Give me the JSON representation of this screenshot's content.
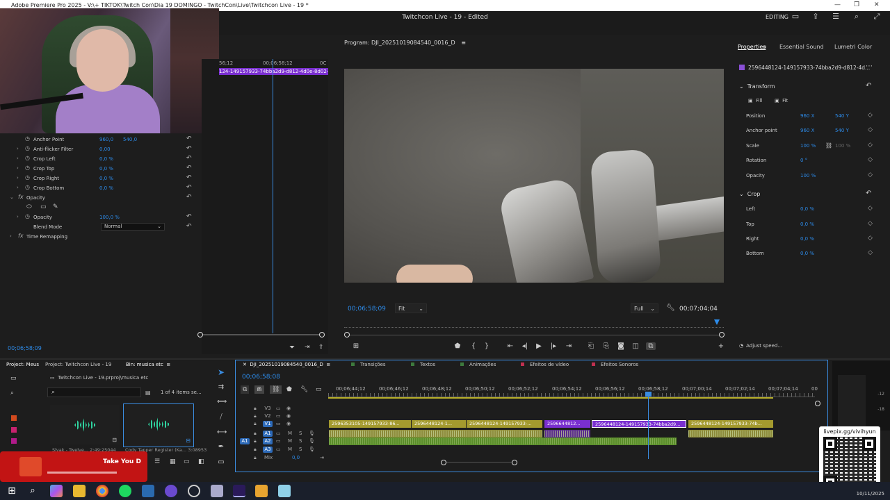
{
  "window": {
    "title": "Adobe Premiere Pro 2025 - V:\\+ TIKTOK\\Twitch Con\\Dia 19 DOMINGO - TwitchCon\\Live\\Twitchcon Live - 19 *",
    "project_title": "Twitchcon Live - 19",
    "edited_label": "Edited",
    "workspace": "EDITING"
  },
  "effect_controls": {
    "rows": [
      {
        "label": "Anchor Point",
        "v1": "960,0",
        "v2": "540,0"
      },
      {
        "label": "Anti-flicker Filter",
        "v1": "0,00",
        "v2": ""
      },
      {
        "label": "Crop Left",
        "v1": "0,0 %",
        "v2": ""
      },
      {
        "label": "Crop Top",
        "v1": "0,0 %",
        "v2": ""
      },
      {
        "label": "Crop Right",
        "v1": "0,0 %",
        "v2": ""
      },
      {
        "label": "Crop Bottom",
        "v1": "0,0 %",
        "v2": ""
      }
    ],
    "opacity_section": "Opacity",
    "opacity_label": "Opacity",
    "opacity_value": "100,0 %",
    "blend_label": "Blend Mode",
    "blend_value": "Normal",
    "time_remapping": "Time Remapping",
    "mini_ruler_left": "56;12",
    "mini_ruler_mid": "00;06;58;12",
    "mini_ruler_right": "0C",
    "mini_clip": "124-149157933-74bba2d9-d812-4d0e-8d02-ce",
    "current_time": "00;06;58;09"
  },
  "program_monitor": {
    "tab": "Program: DJI_20251019084540_0016_D",
    "timecode": "00;06;58;09",
    "zoom": "Fit",
    "resolution": "Full",
    "duration": "00;07;04;04"
  },
  "properties": {
    "tabs": [
      "Properties",
      "Essential Sound",
      "Lumetri Color"
    ],
    "clip_name": "2596448124-149157933-74bba2d9-d812-4d...",
    "transform": "Transform",
    "fill": "Fill",
    "fit": "Fit",
    "rows": [
      {
        "label": "Position",
        "a": "960 X",
        "b": "540 Y"
      },
      {
        "label": "Anchor point",
        "a": "960 X",
        "b": "540 Y"
      },
      {
        "label": "Scale",
        "a": "100 %",
        "b": "100 %"
      },
      {
        "label": "Rotation",
        "a": "0 °",
        "b": ""
      },
      {
        "label": "Opacity",
        "a": "100 %",
        "b": ""
      }
    ],
    "crop": "Crop",
    "crop_rows": [
      {
        "label": "Left",
        "a": "0,0 %"
      },
      {
        "label": "Top",
        "a": "0,0 %"
      },
      {
        "label": "Right",
        "a": "0,0 %"
      },
      {
        "label": "Bottom",
        "a": "0,0 %"
      }
    ],
    "adjust_speed": "Adjust speed..."
  },
  "project_panel": {
    "tabs": [
      "Project: Meus",
      "Project: Twitchcon Live - 19",
      "Bin: musica etc"
    ],
    "path": "Twitchcon Live - 19.prproj\\musica etc",
    "count": "1 of 4 items se...",
    "thumb1_label": "Slvak - Twelve...",
    "thumb1_meta": "2:49:25044",
    "thumb2_label": "Cody Tapper Register (Ka...",
    "thumb2_meta": "3:08953",
    "now_playing": "Take You D"
  },
  "timeline": {
    "tabs": [
      {
        "label": "DJI_20251019084540_0016_D",
        "color": ""
      },
      {
        "label": "Transições",
        "color": "#3d7a3d"
      },
      {
        "label": "Textos",
        "color": "#3d7a3d"
      },
      {
        "label": "Animações",
        "color": "#3d7a3d"
      },
      {
        "label": "Efeitos de vídeo",
        "color": "#c03050"
      },
      {
        "label": "Efeitos Sonoros",
        "color": "#c03050"
      }
    ],
    "current_time": "00;06;58;08",
    "ruler": [
      "00;06;44;12",
      "00;06;46;12",
      "00;06;48;12",
      "00;06;50;12",
      "00;06;52;12",
      "00;06;54;12",
      "00;06;56;12",
      "00;06;58;12",
      "00;07;00;14",
      "00;07;02;14",
      "00;07;04;14",
      "00"
    ],
    "tracks": [
      "V3",
      "V2",
      "V1",
      "A1",
      "A2",
      "A3"
    ],
    "source_patch": "A1",
    "mix_label": "Mix",
    "mix_value": "0,0",
    "video_clips": [
      "2596353105-149157933-86...",
      "2596448124-1...",
      "2596448124-149157933-...",
      "2596644812...",
      "2596448124-149157933-74bba2d9...",
      "2596448124-149157933-74b..."
    ]
  },
  "overlay": {
    "livepix": "livepix.gg/vivihyun"
  },
  "taskbar": {
    "date": "10/11/2025"
  }
}
